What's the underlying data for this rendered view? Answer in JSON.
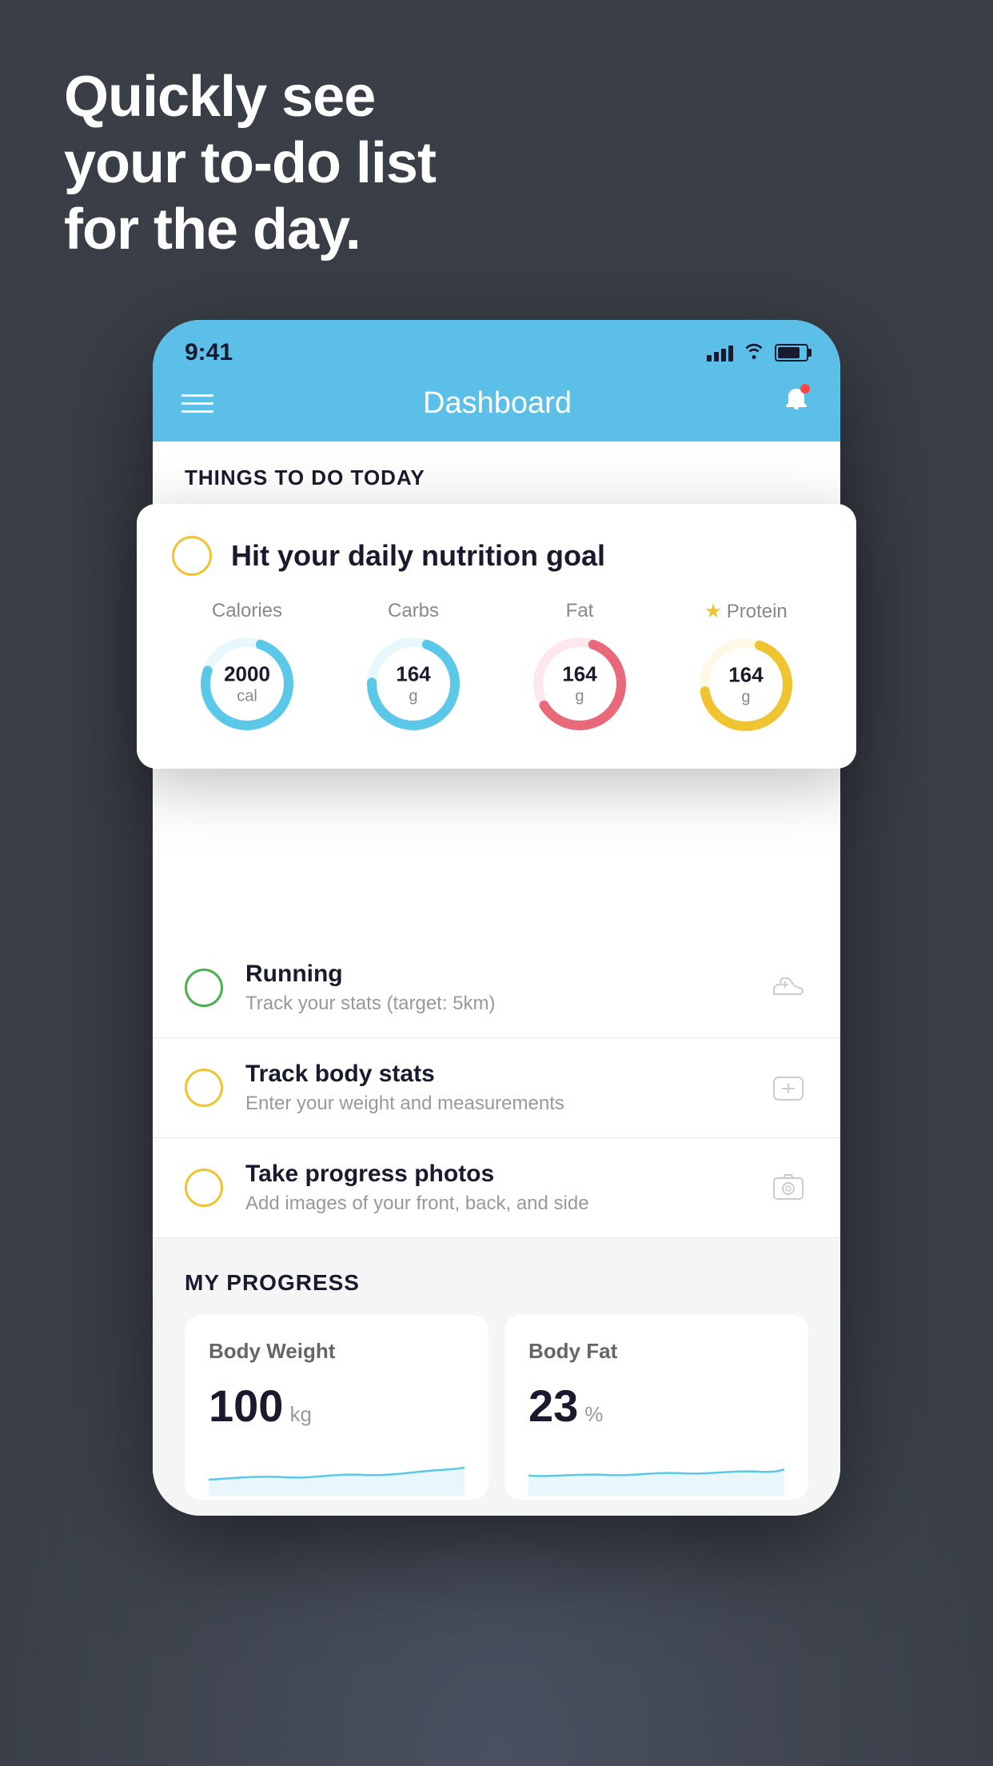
{
  "headline": {
    "line1": "Quickly see",
    "line2": "your to-do list",
    "line3": "for the day."
  },
  "status_bar": {
    "time": "9:41",
    "signal_bars": [
      8,
      12,
      16,
      20
    ],
    "battery_level": "80%"
  },
  "nav": {
    "title": "Dashboard"
  },
  "things_section": {
    "title": "THINGS TO DO TODAY"
  },
  "nutrition_card": {
    "title": "Hit your daily nutrition goal",
    "stats": [
      {
        "label": "Calories",
        "value": "2000",
        "unit": "cal",
        "color": "#5bc8e8",
        "star": false
      },
      {
        "label": "Carbs",
        "value": "164",
        "unit": "g",
        "color": "#5bc8e8",
        "star": false
      },
      {
        "label": "Fat",
        "value": "164",
        "unit": "g",
        "color": "#e86a7a",
        "star": false
      },
      {
        "label": "Protein",
        "value": "164",
        "unit": "g",
        "color": "#f0c430",
        "star": true
      }
    ]
  },
  "todo_items": [
    {
      "title": "Running",
      "subtitle": "Track your stats (target: 5km)",
      "circle_color": "green",
      "icon": "shoe"
    },
    {
      "title": "Track body stats",
      "subtitle": "Enter your weight and measurements",
      "circle_color": "yellow",
      "icon": "scale"
    },
    {
      "title": "Take progress photos",
      "subtitle": "Add images of your front, back, and side",
      "circle_color": "yellow",
      "icon": "photo"
    }
  ],
  "progress_section": {
    "title": "MY PROGRESS",
    "cards": [
      {
        "title": "Body Weight",
        "value": "100",
        "unit": "kg"
      },
      {
        "title": "Body Fat",
        "value": "23",
        "unit": "%"
      }
    ]
  }
}
